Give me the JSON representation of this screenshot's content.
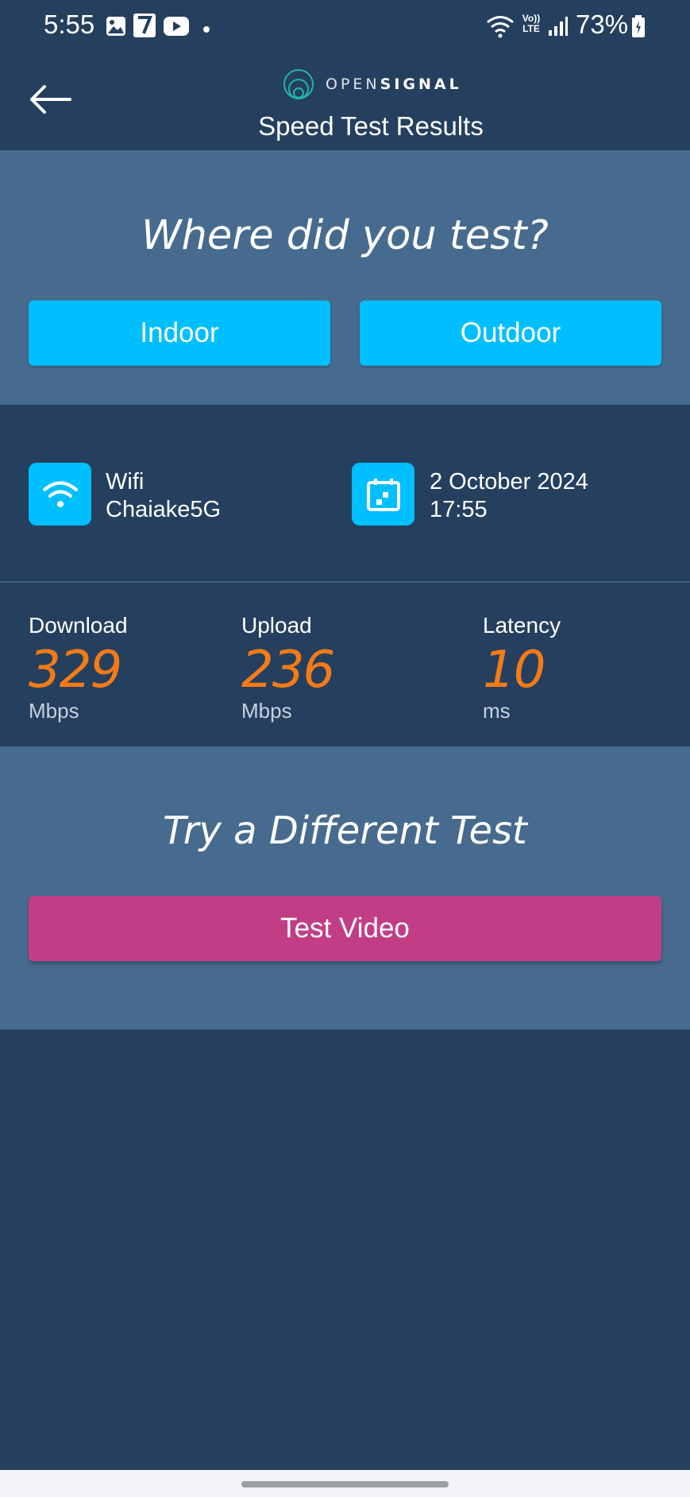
{
  "status_bar": {
    "time": "5:55",
    "battery": "73%",
    "icons": [
      "gallery-icon",
      "seven-eleven-app-icon",
      "youtube-icon",
      "dot-icon",
      "wifi-icon",
      "volte-icon",
      "signal-icon",
      "battery-icon"
    ],
    "volte_label": "Vo)) LTE"
  },
  "header": {
    "logo_prefix": "OPEN",
    "logo_suffix": "SIGNAL",
    "title": "Speed Test Results"
  },
  "where": {
    "title": "Where did you test?",
    "indoor_label": "Indoor",
    "outdoor_label": "Outdoor"
  },
  "connection": {
    "type": "Wifi",
    "network_name": "Chaiake5G",
    "date": "2 October 2024",
    "time": "17:55"
  },
  "results": {
    "download_label": "Download",
    "download_value": "329",
    "download_unit": "Mbps",
    "upload_label": "Upload",
    "upload_value": "236",
    "upload_unit": "Mbps",
    "latency_label": "Latency",
    "latency_value": "10",
    "latency_unit": "ms"
  },
  "different_test": {
    "title": "Try a Different Test",
    "button_label": "Test Video"
  },
  "colors": {
    "background": "#253f5e",
    "panel": "#476b8e",
    "accent_cyan": "#00bfff",
    "accent_orange": "#f47b16",
    "accent_magenta": "#c13e87"
  }
}
